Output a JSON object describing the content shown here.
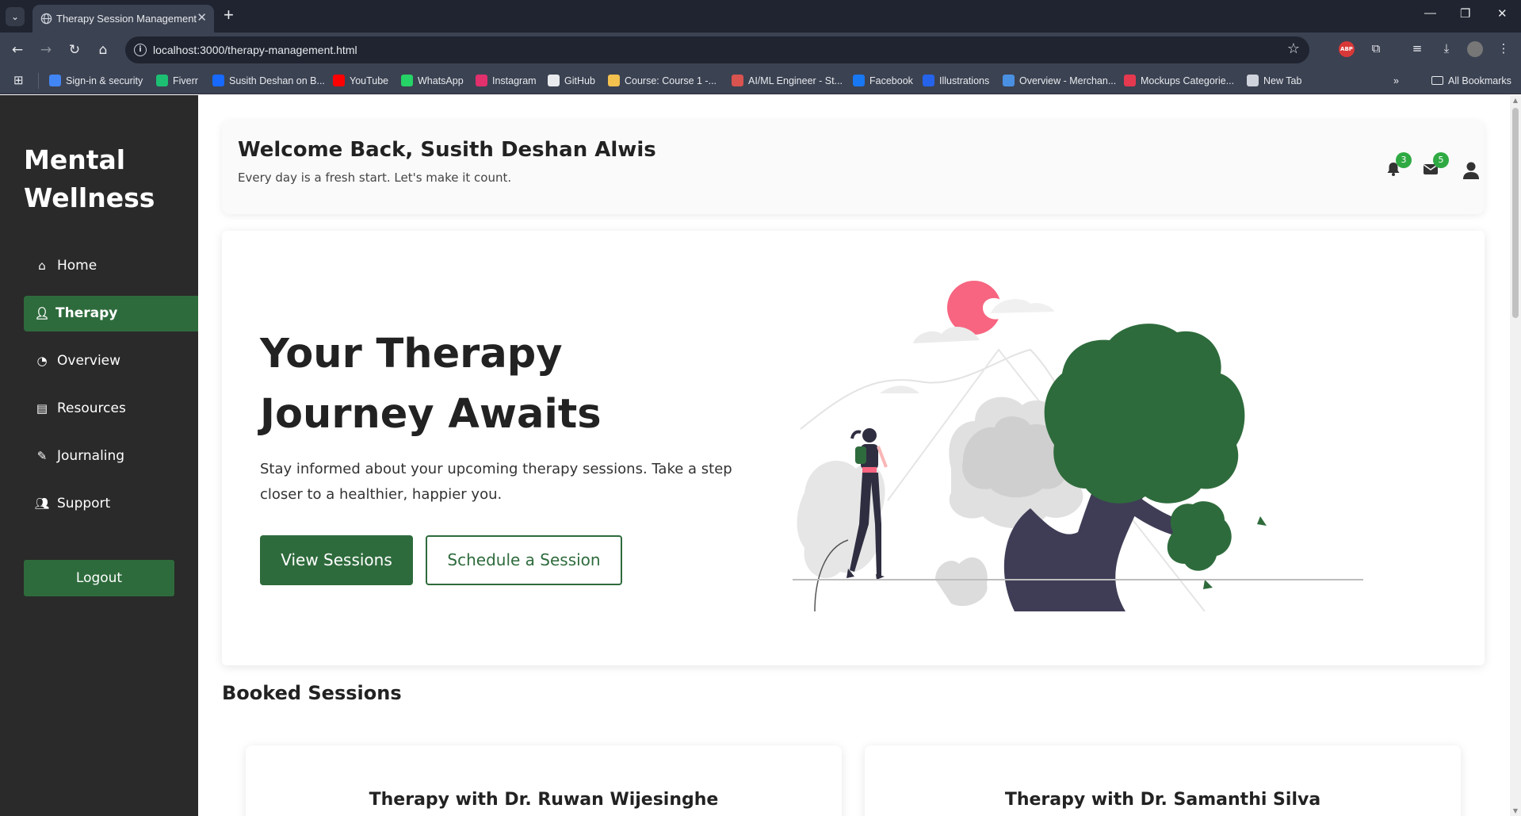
{
  "browser": {
    "tab_title": "Therapy Session Management",
    "url": "localhost:3000/therapy-management.html",
    "bookmarks": [
      {
        "label": "Sign-in & security",
        "color": "#4285f4"
      },
      {
        "label": "Fiverr",
        "color": "#1dbf73"
      },
      {
        "label": "Susith Deshan on B...",
        "color": "#1769ff"
      },
      {
        "label": "YouTube",
        "color": "#ff0000"
      },
      {
        "label": "WhatsApp",
        "color": "#25d366"
      },
      {
        "label": "Instagram",
        "color": "#e1306c"
      },
      {
        "label": "GitHub",
        "color": "#e8eaed"
      },
      {
        "label": "Course: Course 1 -...",
        "color": "#f2c14e"
      },
      {
        "label": "AI/ML Engineer - St...",
        "color": "#d9534f"
      },
      {
        "label": "Facebook",
        "color": "#1877f2"
      },
      {
        "label": "Illustrations",
        "color": "#2563eb"
      },
      {
        "label": "Overview - Merchan...",
        "color": "#4a90e2"
      },
      {
        "label": "Mockups Categorie...",
        "color": "#e53950"
      },
      {
        "label": "New Tab",
        "color": "#cfd3dc"
      }
    ],
    "all_bookmarks": "All Bookmarks"
  },
  "sidebar": {
    "brand": "Mental Wellness",
    "items": [
      {
        "label": "Home",
        "icon": "home-icon",
        "active": false
      },
      {
        "label": "Therapy",
        "icon": "user-icon",
        "active": true
      },
      {
        "label": "Overview",
        "icon": "pie-chart-icon",
        "active": false
      },
      {
        "label": "Resources",
        "icon": "book-icon",
        "active": false
      },
      {
        "label": "Journaling",
        "icon": "pen-icon",
        "active": false
      },
      {
        "label": "Support",
        "icon": "users-icon",
        "active": false
      }
    ],
    "logout": "Logout"
  },
  "header": {
    "welcome": "Welcome Back, Susith Deshan Alwis",
    "subtitle": "Every day is a fresh start. Let's make it count.",
    "notifications_count": "3",
    "messages_count": "5"
  },
  "hero": {
    "title": "Your Therapy Journey Awaits",
    "text": "Stay informed about your upcoming therapy sessions. Take a step closer to a healthier, happier you.",
    "primary_button": "View Sessions",
    "secondary_button": "Schedule a Session"
  },
  "booked": {
    "title": "Booked Sessions",
    "sessions": [
      {
        "title": "Therapy with Dr. Ruwan Wijesinghe"
      },
      {
        "title": "Therapy with Dr. Samanthi Silva"
      }
    ]
  },
  "colors": {
    "accent": "#2e6b3c",
    "sidebar_bg": "#2a2a2a",
    "badge": "#2faa43"
  }
}
